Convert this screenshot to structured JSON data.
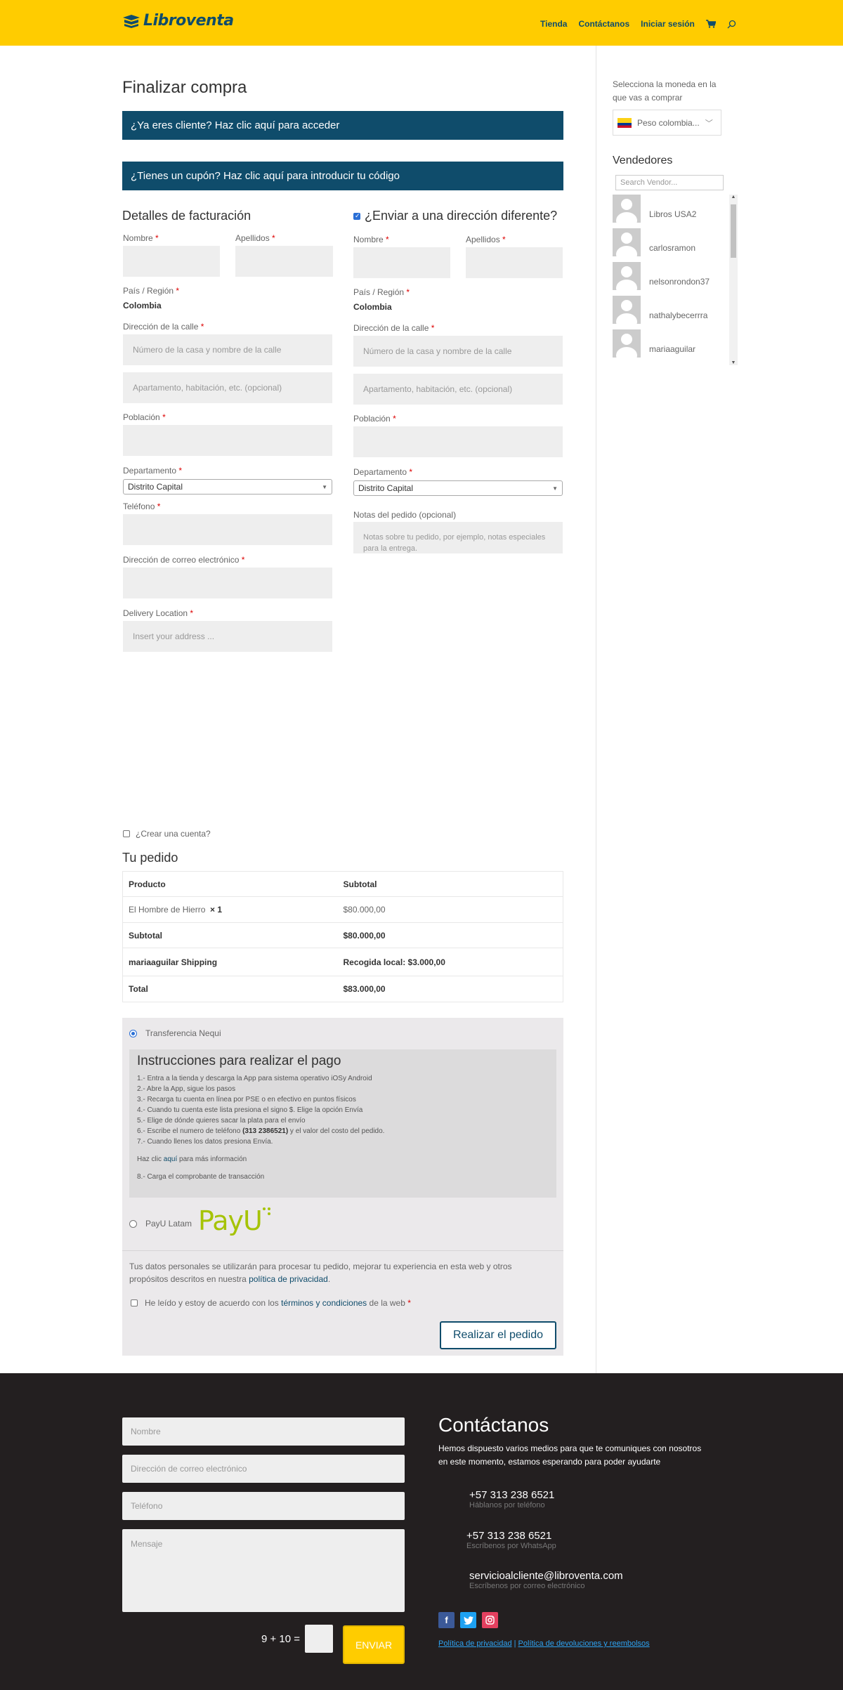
{
  "header": {
    "brand": "Libroventa",
    "nav": [
      "Tienda",
      "Contáctanos",
      "Iniciar sesión"
    ],
    "cart_icon": "cart-icon",
    "search_icon": "search-icon",
    "colors": {
      "header_bg": "#ffcc00",
      "brand": "#0f4c6b",
      "accent": "#0f4c6b"
    }
  },
  "page": {
    "title": "Finalizar compra",
    "login_notice": "¿Ya eres cliente? Haz clic aquí para acceder",
    "coupon_notice": "¿Tienes un cupón? Haz clic aquí para introducir tu código"
  },
  "billing": {
    "title": "Detalles de facturación",
    "first_name_label": "Nombre",
    "last_name_label": "Apellidos",
    "country_label": "País / Región",
    "country_value": "Colombia",
    "street_label": "Dirección de la calle",
    "street_placeholder": "Número de la casa y nombre de la calle",
    "apartment_placeholder": "Apartamento, habitación, etc. (opcional)",
    "city_label": "Población",
    "state_label": "Departamento",
    "state_value": "Distrito Capital",
    "phone_label": "Teléfono",
    "email_label": "Dirección de correo electrónico",
    "delivery_label": "Delivery Location",
    "delivery_placeholder": "Insert your address ..."
  },
  "shipping": {
    "title": "¿Enviar a una dirección diferente?",
    "first_name_label": "Nombre",
    "last_name_label": "Apellidos",
    "country_label": "País / Región",
    "country_value": "Colombia",
    "street_label": "Dirección de la calle",
    "street_placeholder": "Número de la casa y nombre de la calle",
    "apartment_placeholder": "Apartamento, habitación, etc. (opcional)",
    "city_label": "Población",
    "state_label": "Departamento",
    "state_value": "Distrito Capital",
    "notes_label": "Notas del pedido (opcional)",
    "notes_placeholder": "Notas sobre tu pedido, por ejemplo, notas especiales para la entrega."
  },
  "create_account": "¿Crear una cuenta?",
  "order": {
    "title": "Tu pedido",
    "col_product": "Producto",
    "col_subtotal": "Subtotal",
    "item_name": "El Hombre de Hierro",
    "item_qty": "× 1",
    "item_price": "$80.000,00",
    "subtotal_label": "Subtotal",
    "subtotal_value": "$80.000,00",
    "shipping_label": "mariaaguilar Shipping",
    "shipping_value": "Recogida local: $3.000,00",
    "total_label": "Total",
    "total_value": "$83.000,00"
  },
  "payment": {
    "nequi_label": "Transferencia Nequi",
    "instructions_title": "Instrucciones para realizar el pago",
    "steps": [
      "1.- Entra a la tienda y descarga la App para sistema operativo iOSy Android",
      "2.- Abre la App, sigue los pasos",
      "3.- Recarga tu cuenta en línea por PSE o en efectivo en puntos físicos",
      "4.- Cuando tu cuenta este lista presiona el signo $. Elige la opción Envía",
      "5.- Elige de dónde quieres sacar la plata para el envío"
    ],
    "step6_pre": "6.- Escribe el numero de teléfono ",
    "step6_bold": "(313 2386521)",
    "step6_post": " y el valor del costo del pedido.",
    "step7": "7.- Cuando llenes los datos presiona Envía.",
    "more_info_pre": "Haz clic ",
    "more_info_link": "aquí",
    "more_info_post": " para más información",
    "step8": "8.- Carga el comprobante de transacción",
    "payu_label": "PayU Latam",
    "payu_logo": "PayU",
    "privacy_text_pre": "Tus datos personales se utilizarán para procesar tu pedido, mejorar tu experiencia en esta web y otros propósitos descritos en nuestra ",
    "privacy_link": "política de privacidad",
    "privacy_text_post": ".",
    "terms_pre": "He leído y estoy de acuerdo con los ",
    "terms_link": "términos y condiciones",
    "terms_post": " de la web",
    "place_order": "Realizar el pedido"
  },
  "sidebar": {
    "currency_label": "Selecciona la moneda en la que vas a comprar",
    "currency_value": "Peso colombia...",
    "vendors_title": "Vendedores",
    "search_placeholder": "Search Vendor...",
    "vendors": [
      "Libros USA2",
      "carlosramon",
      "nelsonrondon37",
      "nathalybecerrra",
      "mariaaguilar"
    ]
  },
  "footer": {
    "form": {
      "name_placeholder": "Nombre",
      "email_placeholder": "Dirección de correo electrónico",
      "phone_placeholder": "Teléfono",
      "message_placeholder": "Mensaje",
      "captcha": "9 + 10 =",
      "submit": "ENVIAR"
    },
    "contact_title": "Contáctanos",
    "contact_text": "Hemos dispuesto varios medios para que te comuniques con nosotros en este momento, estamos esperando para poder ayudarte",
    "phone1": "+57 313 238 6521",
    "phone1_sub": "Háblanos por teléfono",
    "phone2": "+57 313 238 6521",
    "phone2_sub": "Escríbenos por WhatsApp",
    "email": "servicioalcliente@libroventa.com",
    "email_sub": "Escríbenos por correo electrónico",
    "privacy_link": "Política de privacidad",
    "separator": "|",
    "refund_link": "Política de devoluciones y reembolsos",
    "social": [
      "facebook-icon",
      "twitter-icon",
      "instagram-icon"
    ]
  }
}
